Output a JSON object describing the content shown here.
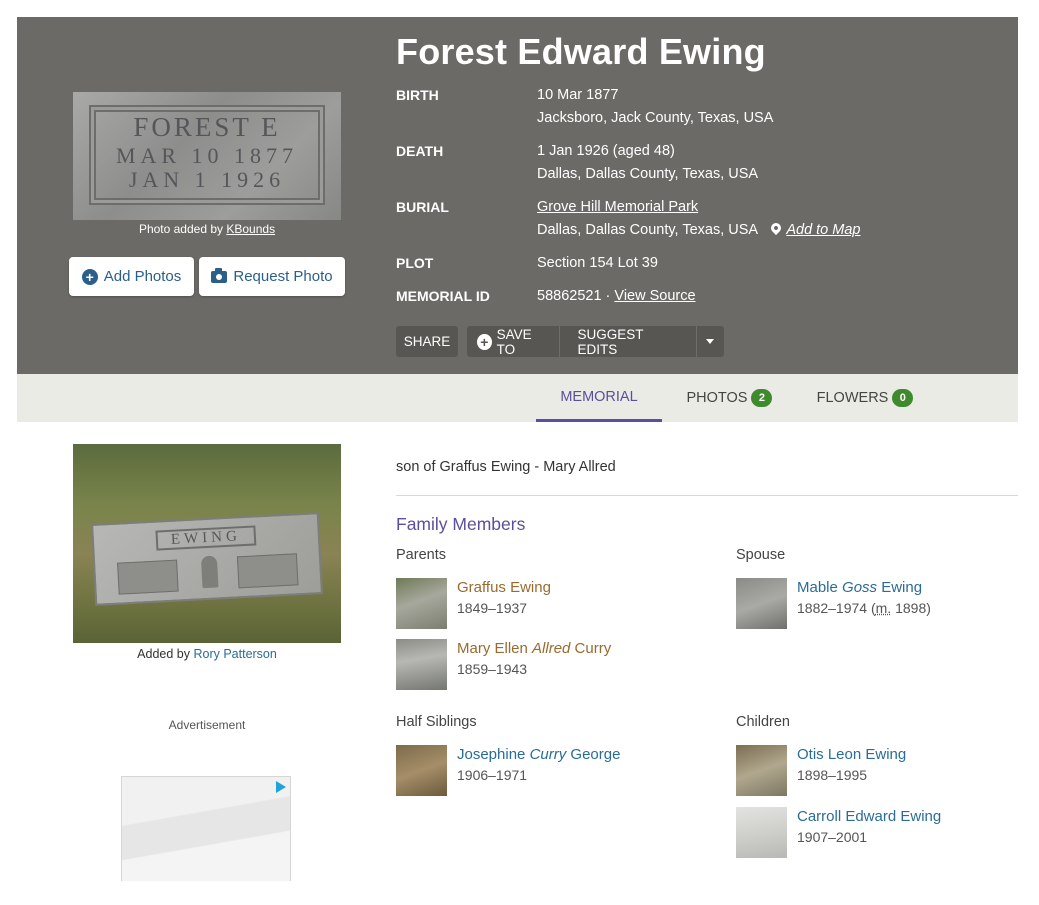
{
  "header": {
    "name": "Forest Edward Ewing",
    "photo_alt": "FOREST E. MAR 10 1877 JAN 1 1926",
    "stone_lines": [
      "FOREST E",
      "MAR 10 1877",
      "JAN 1 1926"
    ],
    "photo_credit_prefix": "Photo added by",
    "photo_credit_user": "KBounds",
    "add_photos_label": "Add Photos",
    "request_photo_label": "Request Photo",
    "facts": {
      "birth_label": "BIRTH",
      "birth_date": "10 Mar 1877",
      "birth_place": "Jacksboro, Jack County, Texas, USA",
      "death_label": "DEATH",
      "death_date": "1 Jan 1926 (aged 48)",
      "death_place": "Dallas, Dallas County, Texas, USA",
      "burial_label": "BURIAL",
      "burial_cemetery": "Grove Hill Memorial Park",
      "burial_place": "Dallas, Dallas County, Texas, USA",
      "add_to_map": "Add to Map",
      "plot_label": "PLOT",
      "plot_value": "Section 154 Lot 39",
      "memorial_id_label": "MEMORIAL ID",
      "memorial_id": "58862521",
      "memorial_id_sep": " · ",
      "view_source": "View Source"
    },
    "actions": {
      "share": "SHARE",
      "save_to": "SAVE TO",
      "suggest_edits": "SUGGEST EDITS"
    }
  },
  "tabs": [
    {
      "label": "MEMORIAL",
      "active": true
    },
    {
      "label": "PHOTOS",
      "count": "2"
    },
    {
      "label": "FLOWERS",
      "count": "0"
    }
  ],
  "sidebar": {
    "stone_title": "EWING",
    "added_by_prefix": "Added by",
    "added_by_user": "Rory Patterson",
    "ad_label": "Advertisement"
  },
  "main": {
    "bio": "son of Graffus Ewing - Mary Allred",
    "family_title": "Family Members",
    "groups": {
      "parents": "Parents",
      "spouse": "Spouse",
      "half_siblings": "Half Siblings",
      "children": "Children"
    },
    "parents": [
      {
        "first": "Graffus Ewing",
        "maiden": "",
        "last": "",
        "dates": "1849–1937"
      },
      {
        "first": "Mary Ellen ",
        "maiden": "Allred",
        "last": " Curry",
        "dates": "1859–1943"
      }
    ],
    "spouse": [
      {
        "first": "Mable ",
        "maiden": "Goss",
        "last": " Ewing",
        "dates": "1882–1974",
        "marriage_prefix": " (",
        "marriage_abbr": "m.",
        "marriage_year": " 1898)"
      }
    ],
    "half_siblings": [
      {
        "first": "Josephine ",
        "maiden": "Curry",
        "last": " George",
        "dates": "1906–1971"
      }
    ],
    "children": [
      {
        "first": "Otis Leon Ewing",
        "dates": "1898–1995"
      },
      {
        "first": "Carroll Edward Ewing",
        "dates": "1907–2001"
      }
    ]
  },
  "colors": {
    "header_bg": "#6b6a66",
    "accent_purple": "#5a4f9c",
    "link_blue": "#2b6c96",
    "link_brown": "#9a6a2e",
    "badge_green": "#3f8a2d",
    "tabbar_bg": "#ebebe6"
  }
}
